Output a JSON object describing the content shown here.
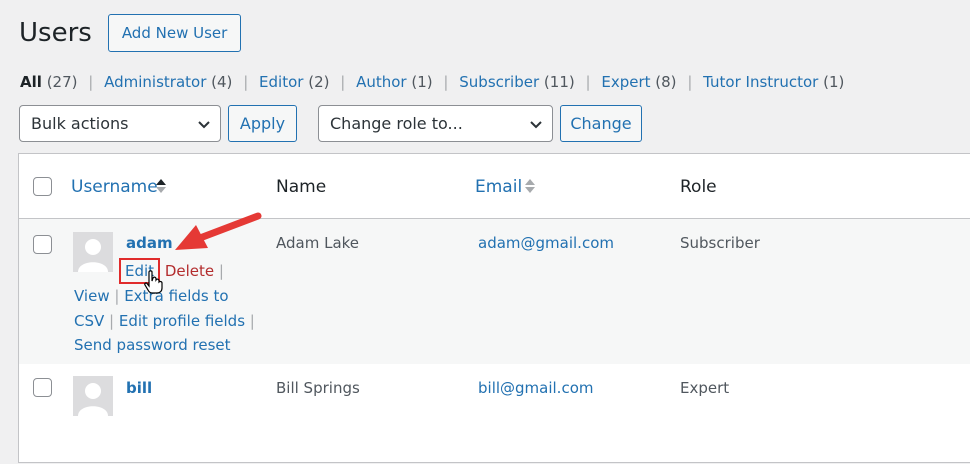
{
  "page": {
    "title": "Users",
    "add_new_label": "Add New User"
  },
  "filters": [
    {
      "label": "All",
      "count": "(27)",
      "current": true
    },
    {
      "label": "Administrator",
      "count": "(4)"
    },
    {
      "label": "Editor",
      "count": "(2)"
    },
    {
      "label": "Author",
      "count": "(1)"
    },
    {
      "label": "Subscriber",
      "count": "(11)"
    },
    {
      "label": "Expert",
      "count": "(8)"
    },
    {
      "label": "Tutor Instructor",
      "count": "(1)"
    }
  ],
  "toolbar": {
    "bulk_actions": "Bulk actions",
    "apply": "Apply",
    "change_role": "Change role to...",
    "change": "Change"
  },
  "columns": {
    "username": "Username",
    "name": "Name",
    "email": "Email",
    "role": "Role"
  },
  "users": [
    {
      "username": "adam",
      "name": "Adam Lake",
      "email": "adam@gmail.com",
      "role": "Subscriber",
      "actions": {
        "edit": "Edit",
        "delete": "Delete",
        "view": "View",
        "extra_fields": "Extra fields to CSV",
        "extra_fields_1": "Extra fields to",
        "extra_fields_2": "CSV",
        "edit_profile": "Edit profile fields",
        "send_reset": "Send password reset"
      }
    },
    {
      "username": "bill",
      "name": "Bill Springs",
      "email": "bill@gmail.com",
      "role": "Expert"
    }
  ],
  "annotation": {
    "arrow_color": "#e53935",
    "highlight_color": "#e02b2b"
  },
  "colors": {
    "link": "#2271b1",
    "delete": "#b32d2e",
    "background": "#f0f0f1"
  }
}
